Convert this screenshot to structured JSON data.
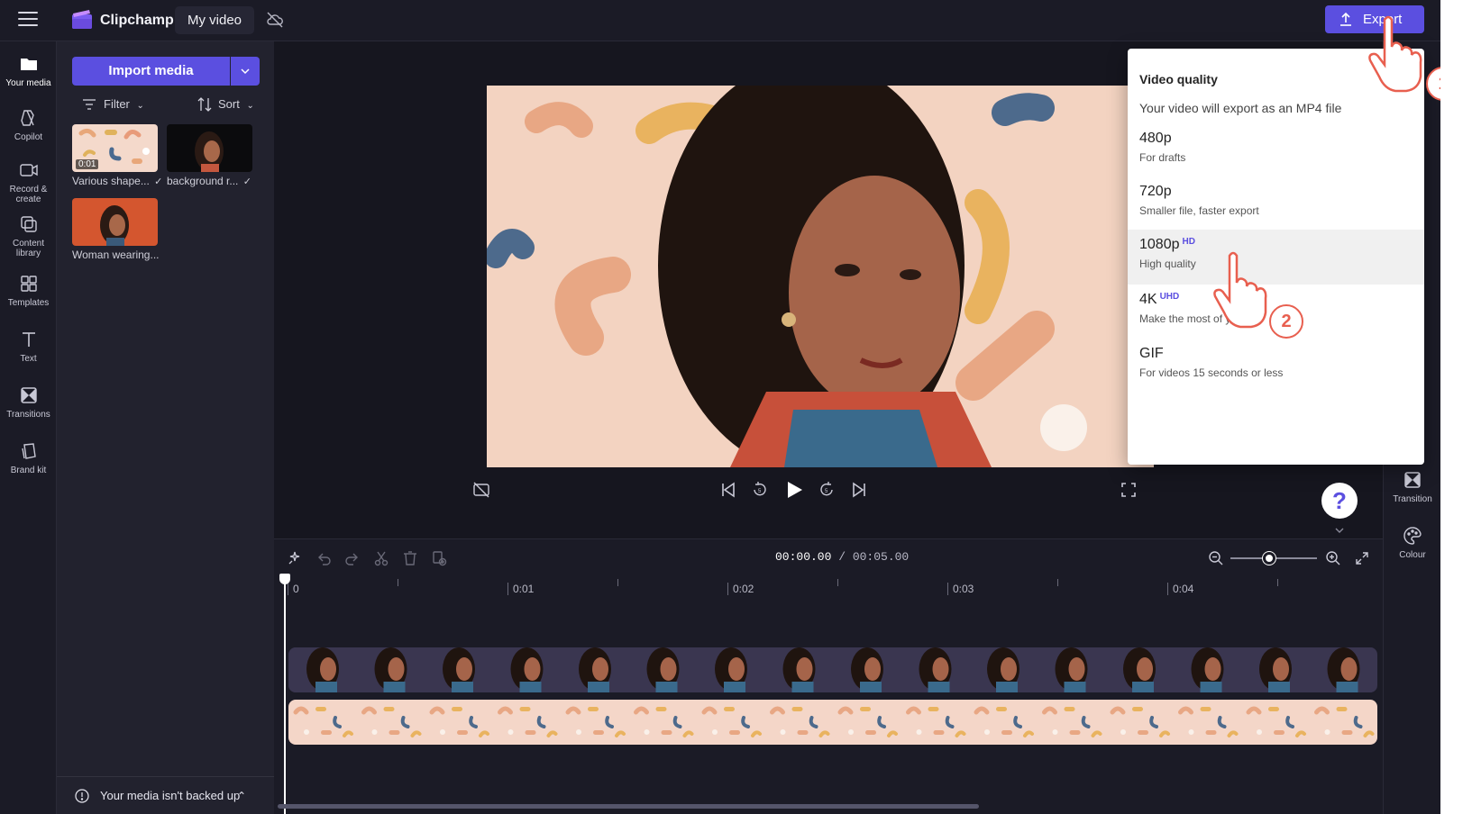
{
  "app": {
    "brand": "Clipchamp",
    "project_name": "My video",
    "export_label": "Export"
  },
  "rail": {
    "items": [
      {
        "label": "Your media",
        "icon": "folder-icon"
      },
      {
        "label": "Copilot",
        "icon": "copilot-icon"
      },
      {
        "label": "Record &\ncreate",
        "icon": "camera-icon"
      },
      {
        "label": "Content\nlibrary",
        "icon": "library-icon"
      },
      {
        "label": "Templates",
        "icon": "templates-icon"
      },
      {
        "label": "Text",
        "icon": "text-icon"
      },
      {
        "label": "Transitions",
        "icon": "transitions-icon"
      },
      {
        "label": "Brand kit",
        "icon": "brand-kit-icon"
      }
    ]
  },
  "media": {
    "import_label": "Import media",
    "filter_label": "Filter",
    "sort_label": "Sort",
    "items": [
      {
        "label": "Various shape...",
        "duration": "0:01",
        "checked": true
      },
      {
        "label": "background r...",
        "checked": true
      },
      {
        "label": "Woman wearing..."
      }
    ],
    "backup_notice": "Your media isn't backed up"
  },
  "export_menu": {
    "title": "Video quality",
    "subtitle": "Your video will export as an MP4 file",
    "options": [
      {
        "name": "480p",
        "badge": "",
        "desc": "For drafts"
      },
      {
        "name": "720p",
        "badge": "",
        "desc": "Smaller file, faster export"
      },
      {
        "name": "1080p",
        "badge": "HD",
        "desc": "High quality"
      },
      {
        "name": "4K",
        "badge": "UHD",
        "desc": "Make the most of your"
      },
      {
        "name": "GIF",
        "badge": "",
        "desc": "For videos 15 seconds or less"
      }
    ]
  },
  "timeline": {
    "current_time": "00:00.00",
    "separator": " / ",
    "duration": "00:05.00",
    "ruler_marks": [
      "0",
      "0:01",
      "0:02",
      "0:03",
      "0:04"
    ]
  },
  "right_rail": {
    "items": [
      {
        "label": "Transition",
        "icon": "transition-icon"
      },
      {
        "label": "Colour",
        "icon": "palette-icon"
      }
    ]
  },
  "help": {
    "label": "?"
  },
  "annotations": {
    "step1": "1",
    "step2": "2"
  },
  "colors": {
    "accent": "#5b4fe0",
    "annotation": "#e85f4f",
    "background": "#1b1b26"
  }
}
